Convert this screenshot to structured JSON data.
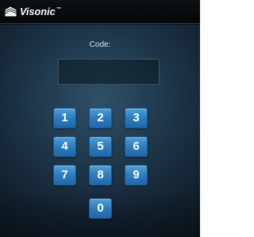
{
  "header": {
    "brand_name": "Visonic",
    "brand_mark": "™",
    "brand_icon": "visonic-logo-icon"
  },
  "login": {
    "code_label": "Code:",
    "code_value": ""
  },
  "keypad": {
    "keys": [
      "1",
      "2",
      "3",
      "4",
      "5",
      "6",
      "7",
      "8",
      "9",
      "0"
    ]
  },
  "colors": {
    "key_blue": "#2c7cbf",
    "background_dark": "#13222f",
    "topbar_black": "#050708"
  }
}
